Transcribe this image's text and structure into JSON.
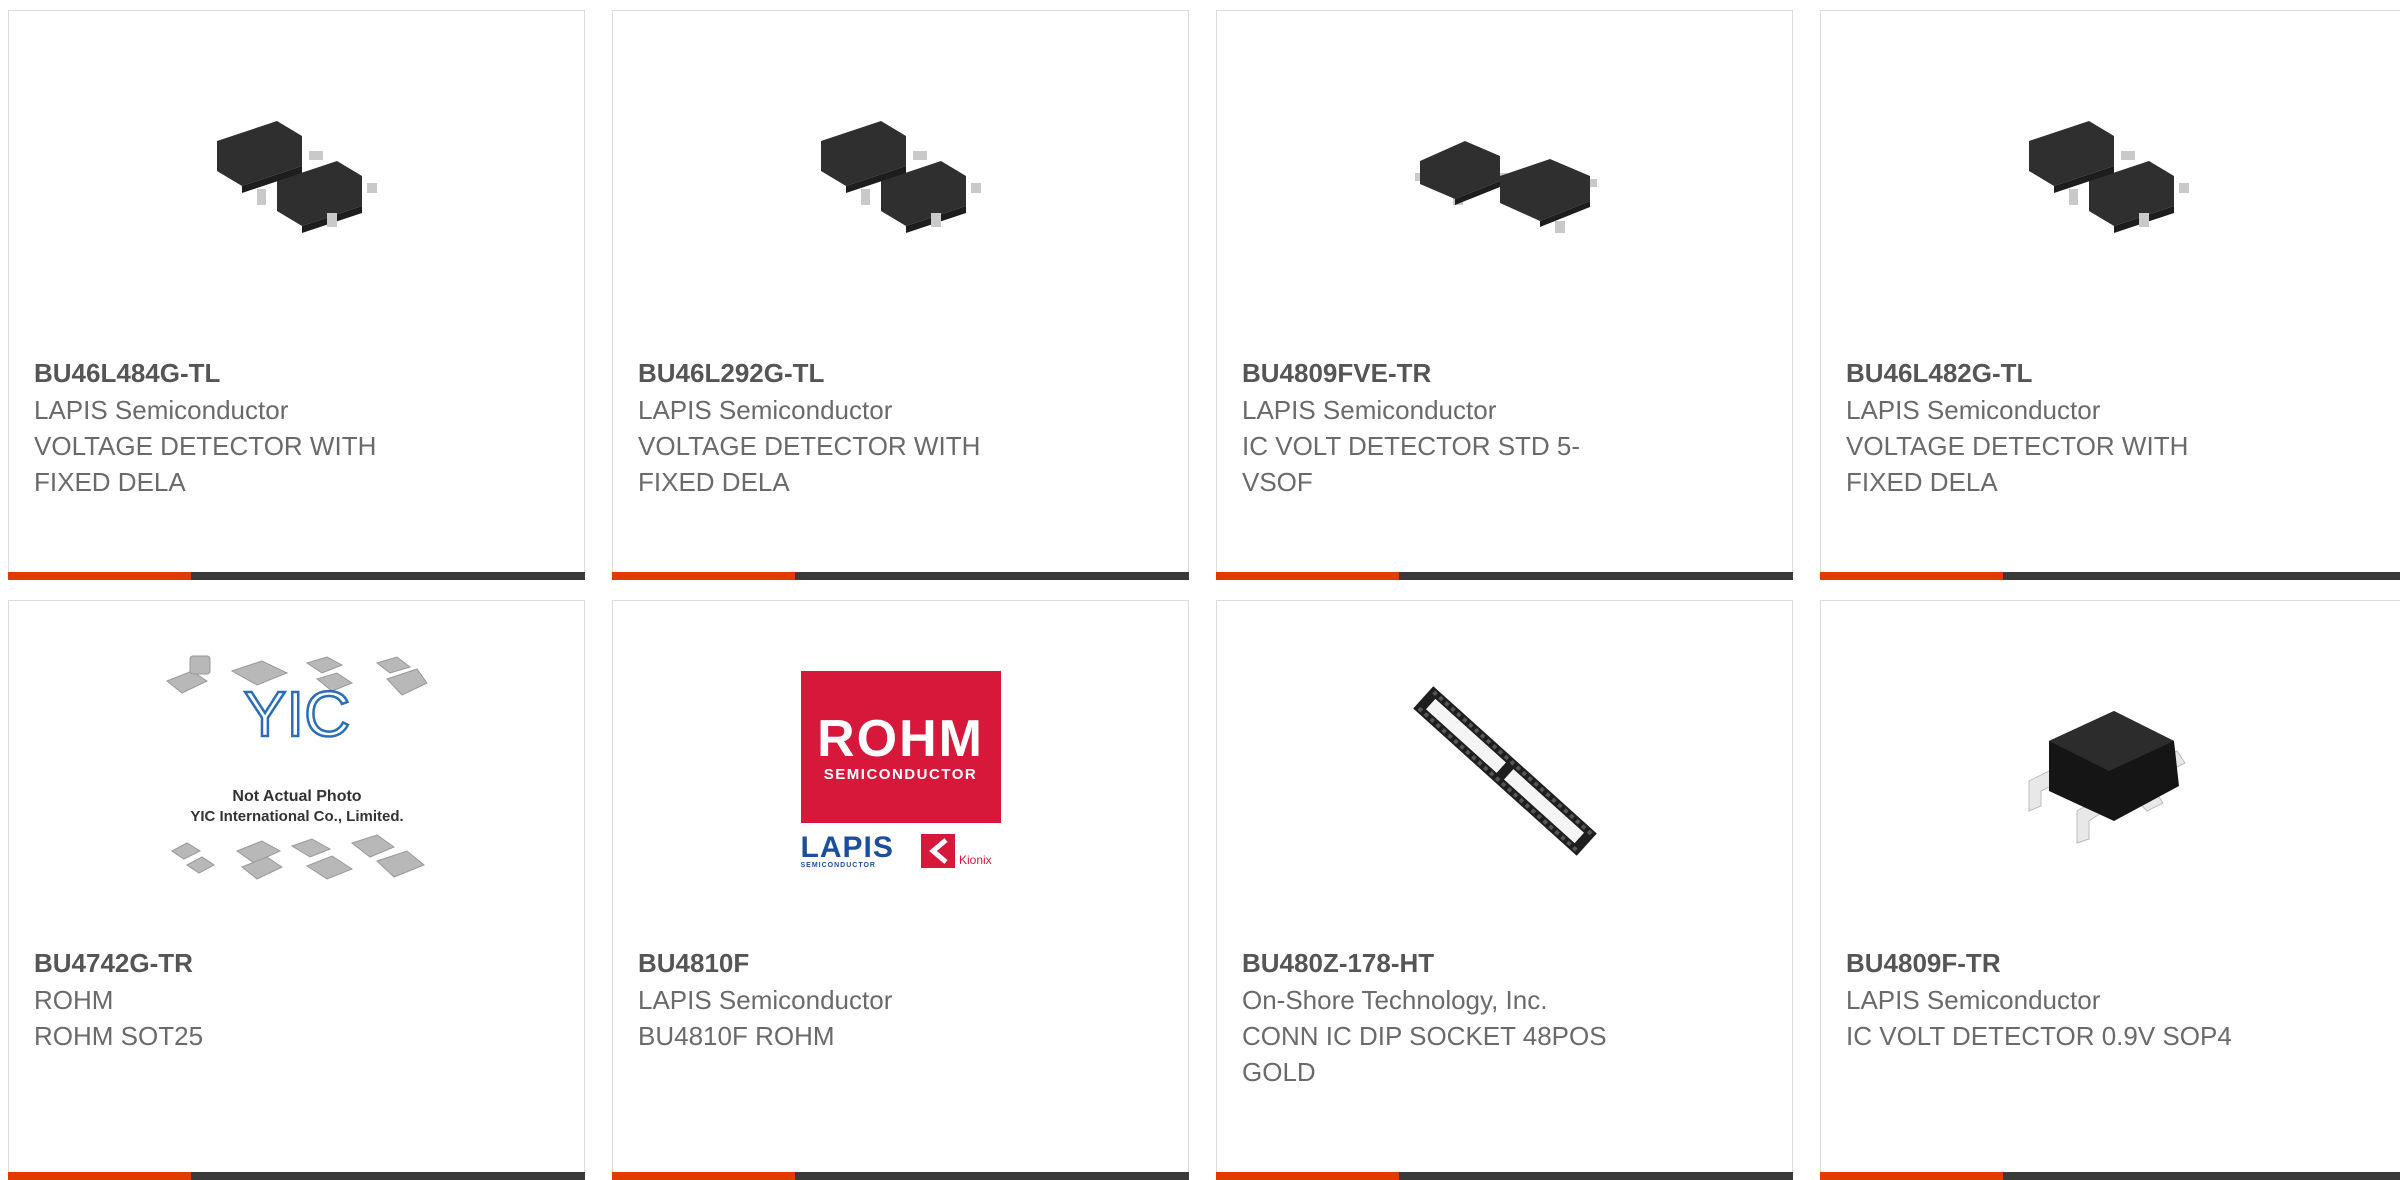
{
  "products": [
    {
      "part": "BU46L484G-TL",
      "manufacturer": "LAPIS Semiconductor",
      "desc1": "VOLTAGE DETECTOR WITH",
      "desc2": "FIXED DELA",
      "image_icon": "sot23-chip-pair-icon"
    },
    {
      "part": "BU46L292G-TL",
      "manufacturer": "LAPIS Semiconductor",
      "desc1": "VOLTAGE DETECTOR WITH",
      "desc2": "FIXED DELA",
      "image_icon": "sot23-chip-pair-icon"
    },
    {
      "part": "BU4809FVE-TR",
      "manufacturer": "LAPIS Semiconductor",
      "desc1": "IC VOLT DETECTOR STD 5-",
      "desc2": "VSOF",
      "image_icon": "vsof-chip-pair-icon"
    },
    {
      "part": "BU46L482G-TL",
      "manufacturer": "LAPIS Semiconductor",
      "desc1": "VOLTAGE DETECTOR WITH",
      "desc2": "FIXED DELA",
      "image_icon": "sot23-chip-pair-icon"
    },
    {
      "part": "BU4742G-TR",
      "manufacturer": "ROHM",
      "desc1": "ROHM SOT25",
      "desc2": "",
      "image_icon": "not-actual-photo-icon",
      "image_caption1": "Not Actual Photo",
      "image_caption2": "YIC International Co., Limited."
    },
    {
      "part": "BU4810F",
      "manufacturer": "LAPIS Semiconductor",
      "desc1": "BU4810F ROHM",
      "desc2": "",
      "image_icon": "rohm-logo-icon",
      "logo_main": "ROHM",
      "logo_sub": "SEMICONDUCTOR",
      "logo_lapis": "LAPIS",
      "logo_lapis_sub": "SEMICONDUCTOR",
      "logo_kionix": "Kionix"
    },
    {
      "part": "BU480Z-178-HT",
      "manufacturer": "On-Shore Technology, Inc.",
      "desc1": "CONN IC DIP SOCKET 48POS",
      "desc2": "GOLD",
      "image_icon": "dip-socket-icon"
    },
    {
      "part": "BU4809F-TR",
      "manufacturer": "LAPIS Semiconductor",
      "desc1": "IC VOLT DETECTOR 0.9V SOP4",
      "desc2": "",
      "image_icon": "sop4-chip-icon"
    }
  ],
  "colors": {
    "accent": "#e03c00",
    "bar": "#3a3a3a",
    "chip": "#2e2e2e",
    "rohm_red": "#d7183a",
    "lapis_blue": "#1b4f9c"
  }
}
